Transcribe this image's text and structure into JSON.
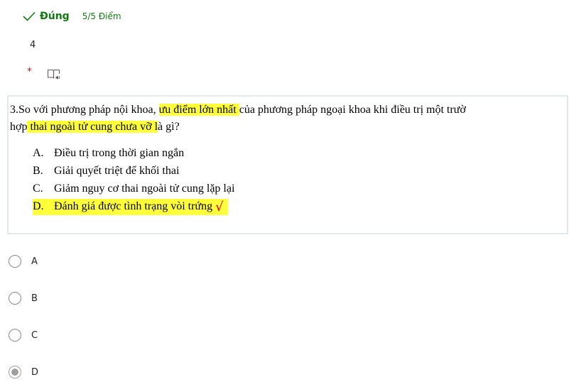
{
  "result": {
    "status_label": "Đúng",
    "score": "5/5 Điểm",
    "color": "#107c10"
  },
  "question": {
    "number": "4",
    "required_mark": "*",
    "reader_icon": "immersive-reader-icon",
    "image": {
      "line1_a": "3.So với phương pháp nội khoa, ",
      "line1_hl": "ưu điểm lớn nhất ",
      "line1_b": "của phương pháp ngoại khoa khi điều trị một trườ",
      "line2_a": "hợp",
      "line2_hl": " thai ngoài tử cung chưa vỡ l",
      "line2_b": "à gì?",
      "options": [
        {
          "letter": "A.",
          "text": "Điều trị trong thời gian ngắn"
        },
        {
          "letter": "B.",
          "text": "Giải quyết triệt để khối thai"
        },
        {
          "letter": "C.",
          "text": "Giảm nguy cơ thai ngoài tử cung lặp lại"
        },
        {
          "letter": "D.",
          "text": "Đánh giá được tình trạng vòi trứng",
          "mark": "√"
        }
      ],
      "highlight_color": "#ffff3a"
    }
  },
  "choices": [
    {
      "label": "A",
      "selected": false
    },
    {
      "label": "B",
      "selected": false
    },
    {
      "label": "C",
      "selected": false
    },
    {
      "label": "D",
      "selected": true
    }
  ]
}
